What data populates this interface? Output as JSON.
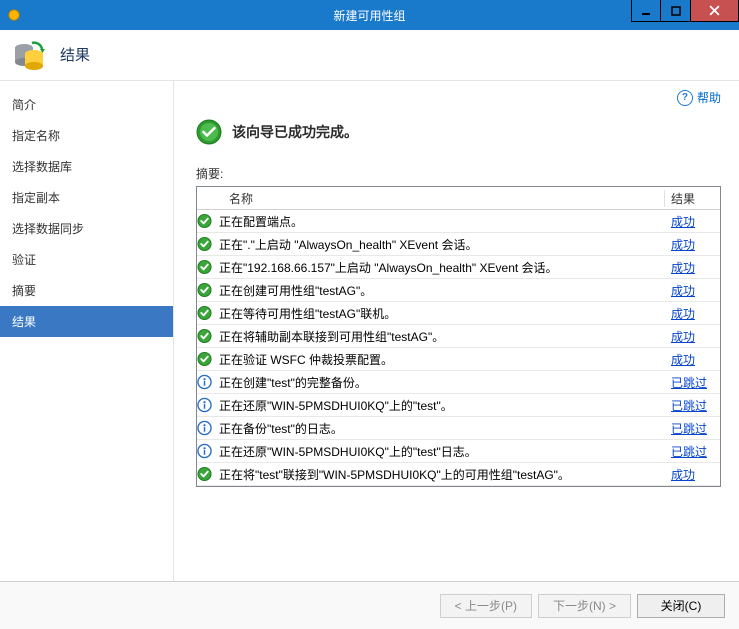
{
  "window": {
    "title": "新建可用性组"
  },
  "header": {
    "title": "结果"
  },
  "sidebar": {
    "items": [
      {
        "label": "简介",
        "active": false
      },
      {
        "label": "指定名称",
        "active": false
      },
      {
        "label": "选择数据库",
        "active": false
      },
      {
        "label": "指定副本",
        "active": false
      },
      {
        "label": "选择数据同步",
        "active": false
      },
      {
        "label": "验证",
        "active": false
      },
      {
        "label": "摘要",
        "active": false
      },
      {
        "label": "结果",
        "active": true
      }
    ]
  },
  "help": {
    "label": "帮助"
  },
  "wizard": {
    "success_message": "该向导已成功完成。",
    "summary_label": "摘要:"
  },
  "grid": {
    "columns": {
      "name": "名称",
      "result": "结果"
    },
    "rows": [
      {
        "icon": "success",
        "name": "正在配置端点。",
        "result": "成功",
        "result_type": "link"
      },
      {
        "icon": "success",
        "name": "正在\".\"上启动 \"AlwaysOn_health\" XEvent 会话。",
        "result": "成功",
        "result_type": "link"
      },
      {
        "icon": "success",
        "name": "正在\"192.168.66.157\"上启动 \"AlwaysOn_health\" XEvent 会话。",
        "result": "成功",
        "result_type": "link"
      },
      {
        "icon": "success",
        "name": "正在创建可用性组\"testAG\"。",
        "result": "成功",
        "result_type": "link"
      },
      {
        "icon": "success",
        "name": "正在等待可用性组\"testAG\"联机。",
        "result": "成功",
        "result_type": "link"
      },
      {
        "icon": "success",
        "name": "正在将辅助副本联接到可用性组\"testAG\"。",
        "result": "成功",
        "result_type": "link"
      },
      {
        "icon": "success",
        "name": "正在验证 WSFC 仲裁投票配置。",
        "result": "成功",
        "result_type": "link"
      },
      {
        "icon": "info",
        "name": "正在创建\"test\"的完整备份。",
        "result": "已跳过",
        "result_type": "link"
      },
      {
        "icon": "info",
        "name": "正在还原\"WIN-5PMSDHUI0KQ\"上的\"test\"。",
        "result": "已跳过",
        "result_type": "link"
      },
      {
        "icon": "info",
        "name": "正在备份\"test\"的日志。",
        "result": "已跳过",
        "result_type": "link"
      },
      {
        "icon": "info",
        "name": "正在还原\"WIN-5PMSDHUI0KQ\"上的\"test\"日志。",
        "result": "已跳过",
        "result_type": "link"
      },
      {
        "icon": "success",
        "name": "正在将\"test\"联接到\"WIN-5PMSDHUI0KQ\"上的可用性组\"testAG\"。",
        "result": "成功",
        "result_type": "link"
      }
    ]
  },
  "footer": {
    "prev": "< 上一步(P)",
    "next": "下一步(N) >",
    "close": "关闭(C)"
  }
}
